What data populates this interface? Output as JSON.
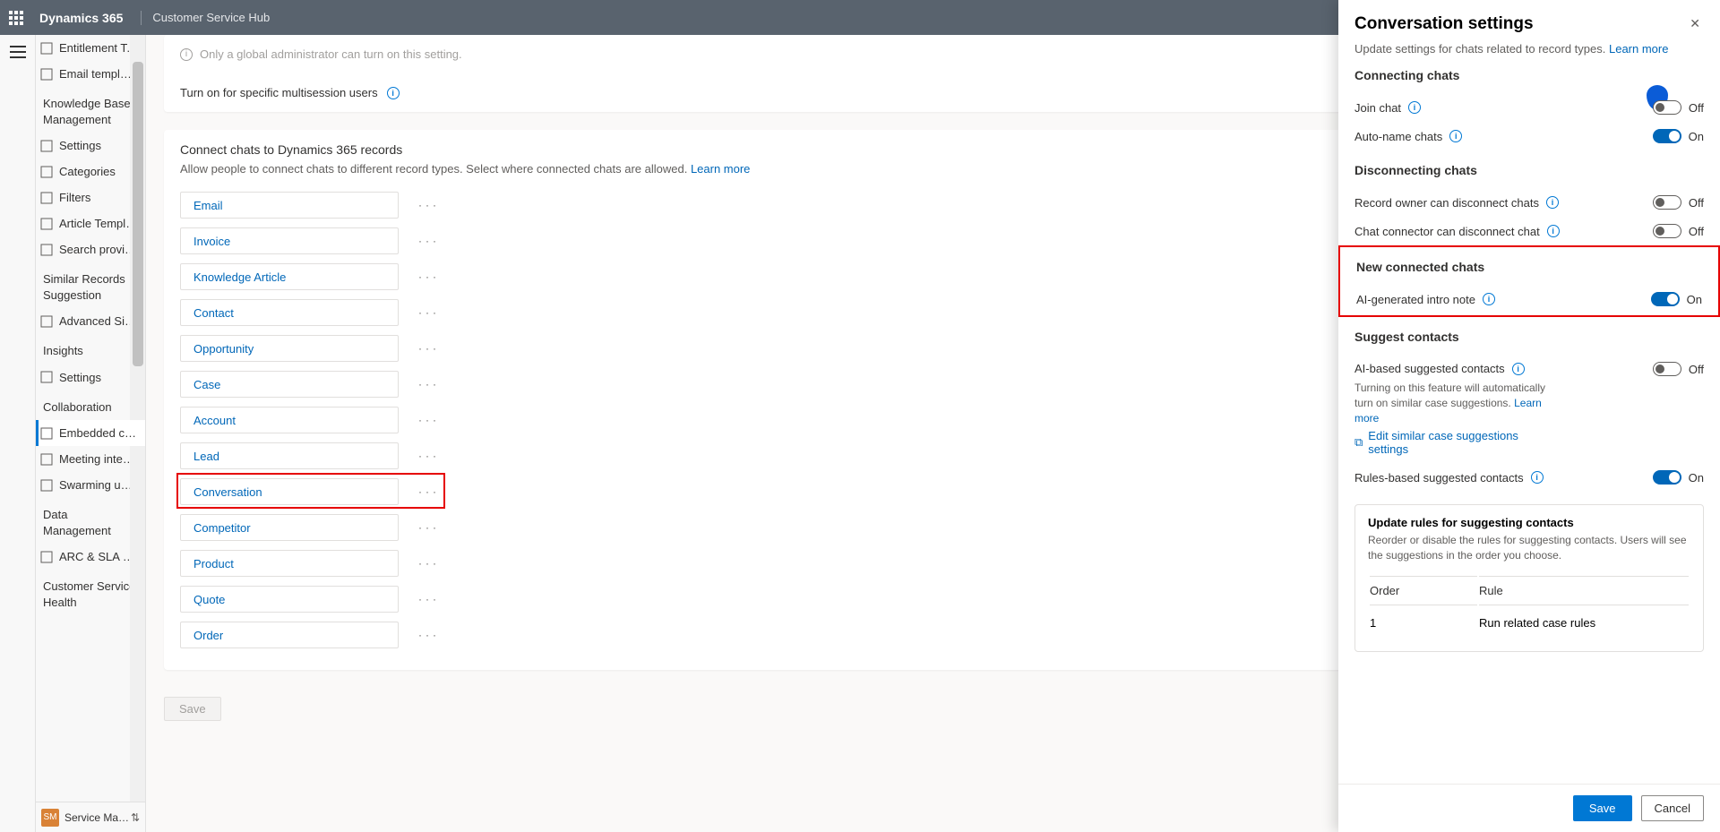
{
  "topbar": {
    "title": "Dynamics 365",
    "subtitle": "Customer Service Hub"
  },
  "sidebar": {
    "items_top": [
      {
        "label": "Entitlement Templ…"
      },
      {
        "label": "Email templates"
      }
    ],
    "group_kb": "Knowledge Base Management",
    "items_kb": [
      {
        "label": "Settings"
      },
      {
        "label": "Categories"
      },
      {
        "label": "Filters"
      },
      {
        "label": "Article Templates"
      },
      {
        "label": "Search providers"
      }
    ],
    "group_sim": "Similar Records Suggestion",
    "items_sim": [
      {
        "label": "Advanced Similari…"
      }
    ],
    "group_ins": "Insights",
    "items_ins": [
      {
        "label": "Settings"
      }
    ],
    "group_col": "Collaboration",
    "items_col": [
      {
        "label": "Embedded chat u…",
        "selected": true
      },
      {
        "label": "Meeting integrati…"
      },
      {
        "label": "Swarming using T…"
      }
    ],
    "group_dm": "Data Management",
    "items_dm": [
      {
        "label": "ARC & SLA Migra…"
      }
    ],
    "group_csh": "Customer Service Health",
    "switcher": {
      "avatar": "SM",
      "label": "Service Managem…"
    }
  },
  "main": {
    "admin_note": "Only a global administrator can turn on this setting.",
    "multi_label": "Turn on for specific multisession users",
    "connect": {
      "title": "Connect chats to Dynamics 365 records",
      "desc": "Allow people to connect chats to different record types. Select where connected chats are allowed. ",
      "learn": "Learn more",
      "records": [
        "Email",
        "Invoice",
        "Knowledge Article",
        "Contact",
        "Opportunity",
        "Case",
        "Account",
        "Lead",
        "Conversation",
        "Competitor",
        "Product",
        "Quote",
        "Order"
      ],
      "hl_index": 8
    },
    "save": "Save"
  },
  "panel": {
    "title": "Conversation settings",
    "crumb_a": "Update settings for chats related to record types. ",
    "crumb_b": "Learn more",
    "sec_conn": "Connecting chats",
    "join": "Join chat",
    "auto": "Auto-name chats",
    "sec_disc": "Disconnecting chats",
    "disc_owner": "Record owner can disconnect chats",
    "disc_conn": "Chat connector can disconnect chat",
    "sec_new": "New connected chats",
    "ai_note": "AI-generated intro note",
    "sec_sugg": "Suggest contacts",
    "ai_contacts": "AI-based suggested contacts",
    "ai_contacts_note": "Turning on this feature will automatically turn on similar case suggestions. ",
    "ai_contacts_learn": "Learn more",
    "edit_similar": "Edit similar case suggestions settings",
    "rules_contacts": "Rules-based suggested contacts",
    "rules_card": {
      "title": "Update rules for suggesting contacts",
      "desc": "Reorder or disable the rules for suggesting contacts. Users will see the suggestions in the order you choose.",
      "col_order": "Order",
      "col_rule": "Rule",
      "rows": [
        {
          "order": "1",
          "rule": "Run related case rules"
        }
      ]
    },
    "off": "Off",
    "on": "On",
    "save": "Save",
    "cancel": "Cancel"
  }
}
